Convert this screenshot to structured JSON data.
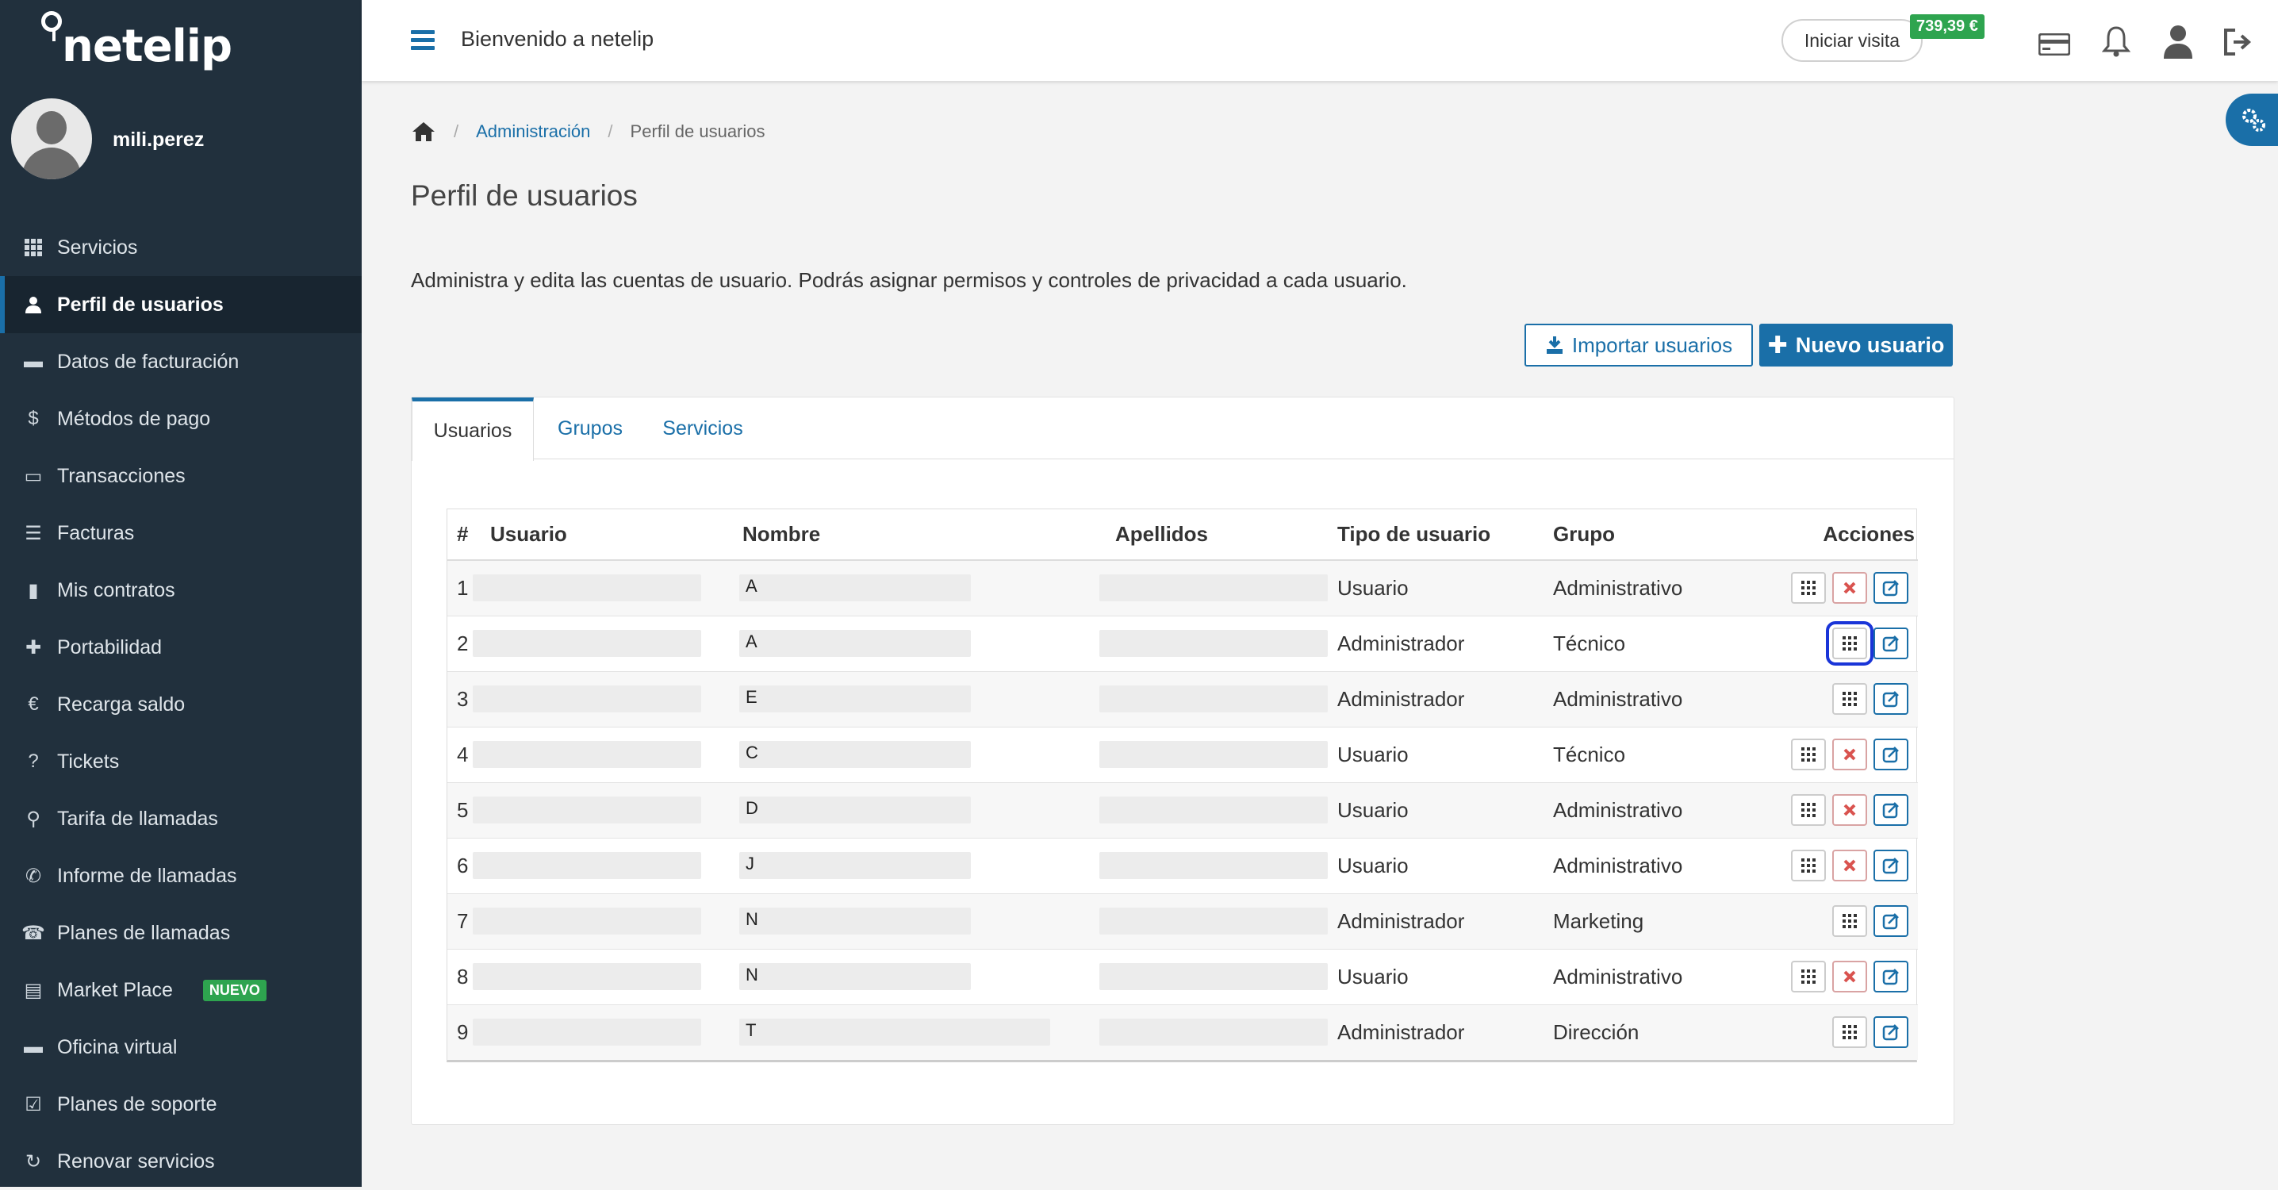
{
  "brand": {
    "name": "netelip"
  },
  "user": {
    "name": "mili.perez"
  },
  "nav": [
    {
      "label": "Servicios",
      "icon": "grid-icon",
      "name": "nav-servicios"
    },
    {
      "label": "Perfil de usuarios",
      "icon": "user-icon",
      "name": "nav-perfil-usuarios",
      "active": true
    },
    {
      "label": "Datos de facturación",
      "icon": "briefcase-icon",
      "name": "nav-datos-facturacion"
    },
    {
      "label": "Métodos de pago",
      "icon": "dollar-icon",
      "name": "nav-metodos-pago"
    },
    {
      "label": "Transacciones",
      "icon": "credit-card-icon",
      "name": "nav-transacciones"
    },
    {
      "label": "Facturas",
      "icon": "list-icon",
      "name": "nav-facturas"
    },
    {
      "label": "Mis contratos",
      "icon": "document-icon",
      "name": "nav-mis-contratos"
    },
    {
      "label": "Portabilidad",
      "icon": "plus-icon",
      "name": "nav-portabilidad"
    },
    {
      "label": "Recarga saldo",
      "icon": "euro-icon",
      "name": "nav-recarga-saldo"
    },
    {
      "label": "Tickets",
      "icon": "question-icon",
      "name": "nav-tickets"
    },
    {
      "label": "Tarifa de llamadas",
      "icon": "search-icon",
      "name": "nav-tarifa-llamadas"
    },
    {
      "label": "Informe de llamadas",
      "icon": "phone-icon",
      "name": "nav-informe-llamadas"
    },
    {
      "label": "Planes de llamadas",
      "icon": "telephone-icon",
      "name": "nav-planes-llamadas"
    },
    {
      "label": "Market Place",
      "icon": "presentation-icon",
      "name": "nav-market-place",
      "badge": "NUEVO"
    },
    {
      "label": "Oficina virtual",
      "icon": "briefcase-icon",
      "name": "nav-oficina-virtual"
    },
    {
      "label": "Planes de soporte",
      "icon": "checkbox-icon",
      "name": "nav-planes-soporte"
    },
    {
      "label": "Renovar servicios",
      "icon": "refresh-icon",
      "name": "nav-renovar-servicios"
    }
  ],
  "topbar": {
    "welcome": "Bienvenido a netelip",
    "visit_button": "Iniciar visita",
    "balance": "739,39 €"
  },
  "breadcrumb": {
    "admin": "Administración",
    "current": "Perfil de usuarios"
  },
  "page": {
    "title": "Perfil de usuarios",
    "description": "Administra y edita las cuentas de usuario. Podrás asignar permisos y controles de privacidad a cada usuario.",
    "import_button": "Importar usuarios",
    "new_button": "Nuevo usuario"
  },
  "tabs": [
    "Usuarios",
    "Grupos",
    "Servicios"
  ],
  "table": {
    "headers": [
      "#",
      "Usuario",
      "Nombre",
      "Apellidos",
      "Tipo de usuario",
      "Grupo",
      "Acciones"
    ],
    "rows": [
      {
        "num": "1",
        "user_hint": "",
        "name_hint": "A",
        "type": "Usuario",
        "group": "Administrativo",
        "del": true
      },
      {
        "num": "2",
        "user_hint": "",
        "name_hint": "A",
        "type": "Administrador",
        "group": "Técnico",
        "del": false,
        "highlight": true
      },
      {
        "num": "3",
        "user_hint": "",
        "name_hint": "E",
        "type": "Administrador",
        "group": "Administrativo",
        "del": false
      },
      {
        "num": "4",
        "user_hint": "",
        "name_hint": "C",
        "type": "Usuario",
        "group": "Técnico",
        "del": true
      },
      {
        "num": "5",
        "user_hint": "",
        "name_hint": "D",
        "type": "Usuario",
        "group": "Administrativo",
        "del": true
      },
      {
        "num": "6",
        "user_hint": "",
        "name_hint": "J",
        "type": "Usuario",
        "group": "Administrativo",
        "del": true
      },
      {
        "num": "7",
        "user_hint": "",
        "name_hint": "N",
        "type": "Administrador",
        "group": "Marketing",
        "del": false
      },
      {
        "num": "8",
        "user_hint": "",
        "name_hint": "N",
        "type": "Usuario",
        "group": "Administrativo",
        "del": true
      },
      {
        "num": "9",
        "user_hint": "",
        "name_hint": "T",
        "type": "Administrador",
        "group": "Dirección",
        "del": false
      }
    ]
  },
  "colors": {
    "accent": "#1a6fa8",
    "sidebar": "#21303d",
    "success": "#2ea44f",
    "danger": "#d9534f"
  }
}
